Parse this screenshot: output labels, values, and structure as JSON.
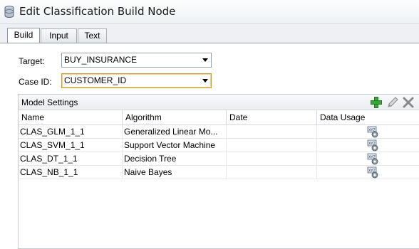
{
  "window": {
    "title": "Edit Classification Build Node",
    "icon": "database-node-icon"
  },
  "tabs": [
    {
      "label": "Build",
      "active": true
    },
    {
      "label": "Input",
      "active": false
    },
    {
      "label": "Text",
      "active": false
    }
  ],
  "form": {
    "target_label": "Target:",
    "target_value": "BUY_INSURANCE",
    "case_id_label": "Case ID:",
    "case_id_value": "CUSTOMER_ID"
  },
  "model_settings": {
    "title": "Model Settings",
    "toolbar": [
      "add-icon",
      "edit-icon",
      "delete-icon"
    ],
    "columns": [
      "Name",
      "Algorithm",
      "Date",
      "Data Usage"
    ],
    "rows": [
      {
        "name": "CLAS_GLM_1_1",
        "algorithm": "Generalized Linear Mo...",
        "date": "",
        "data_usage_icon": "data-usage-icon"
      },
      {
        "name": "CLAS_SVM_1_1",
        "algorithm": "Support Vector Machine",
        "date": "",
        "data_usage_icon": "data-usage-icon"
      },
      {
        "name": "CLAS_DT_1_1",
        "algorithm": "Decision Tree",
        "date": "",
        "data_usage_icon": "data-usage-icon"
      },
      {
        "name": "CLAS_NB_1_1",
        "algorithm": "Naive Bayes",
        "date": "",
        "data_usage_icon": "data-usage-icon"
      }
    ]
  },
  "colors": {
    "add_green": "#3aa53a",
    "focus_border": "#c89b3c"
  }
}
